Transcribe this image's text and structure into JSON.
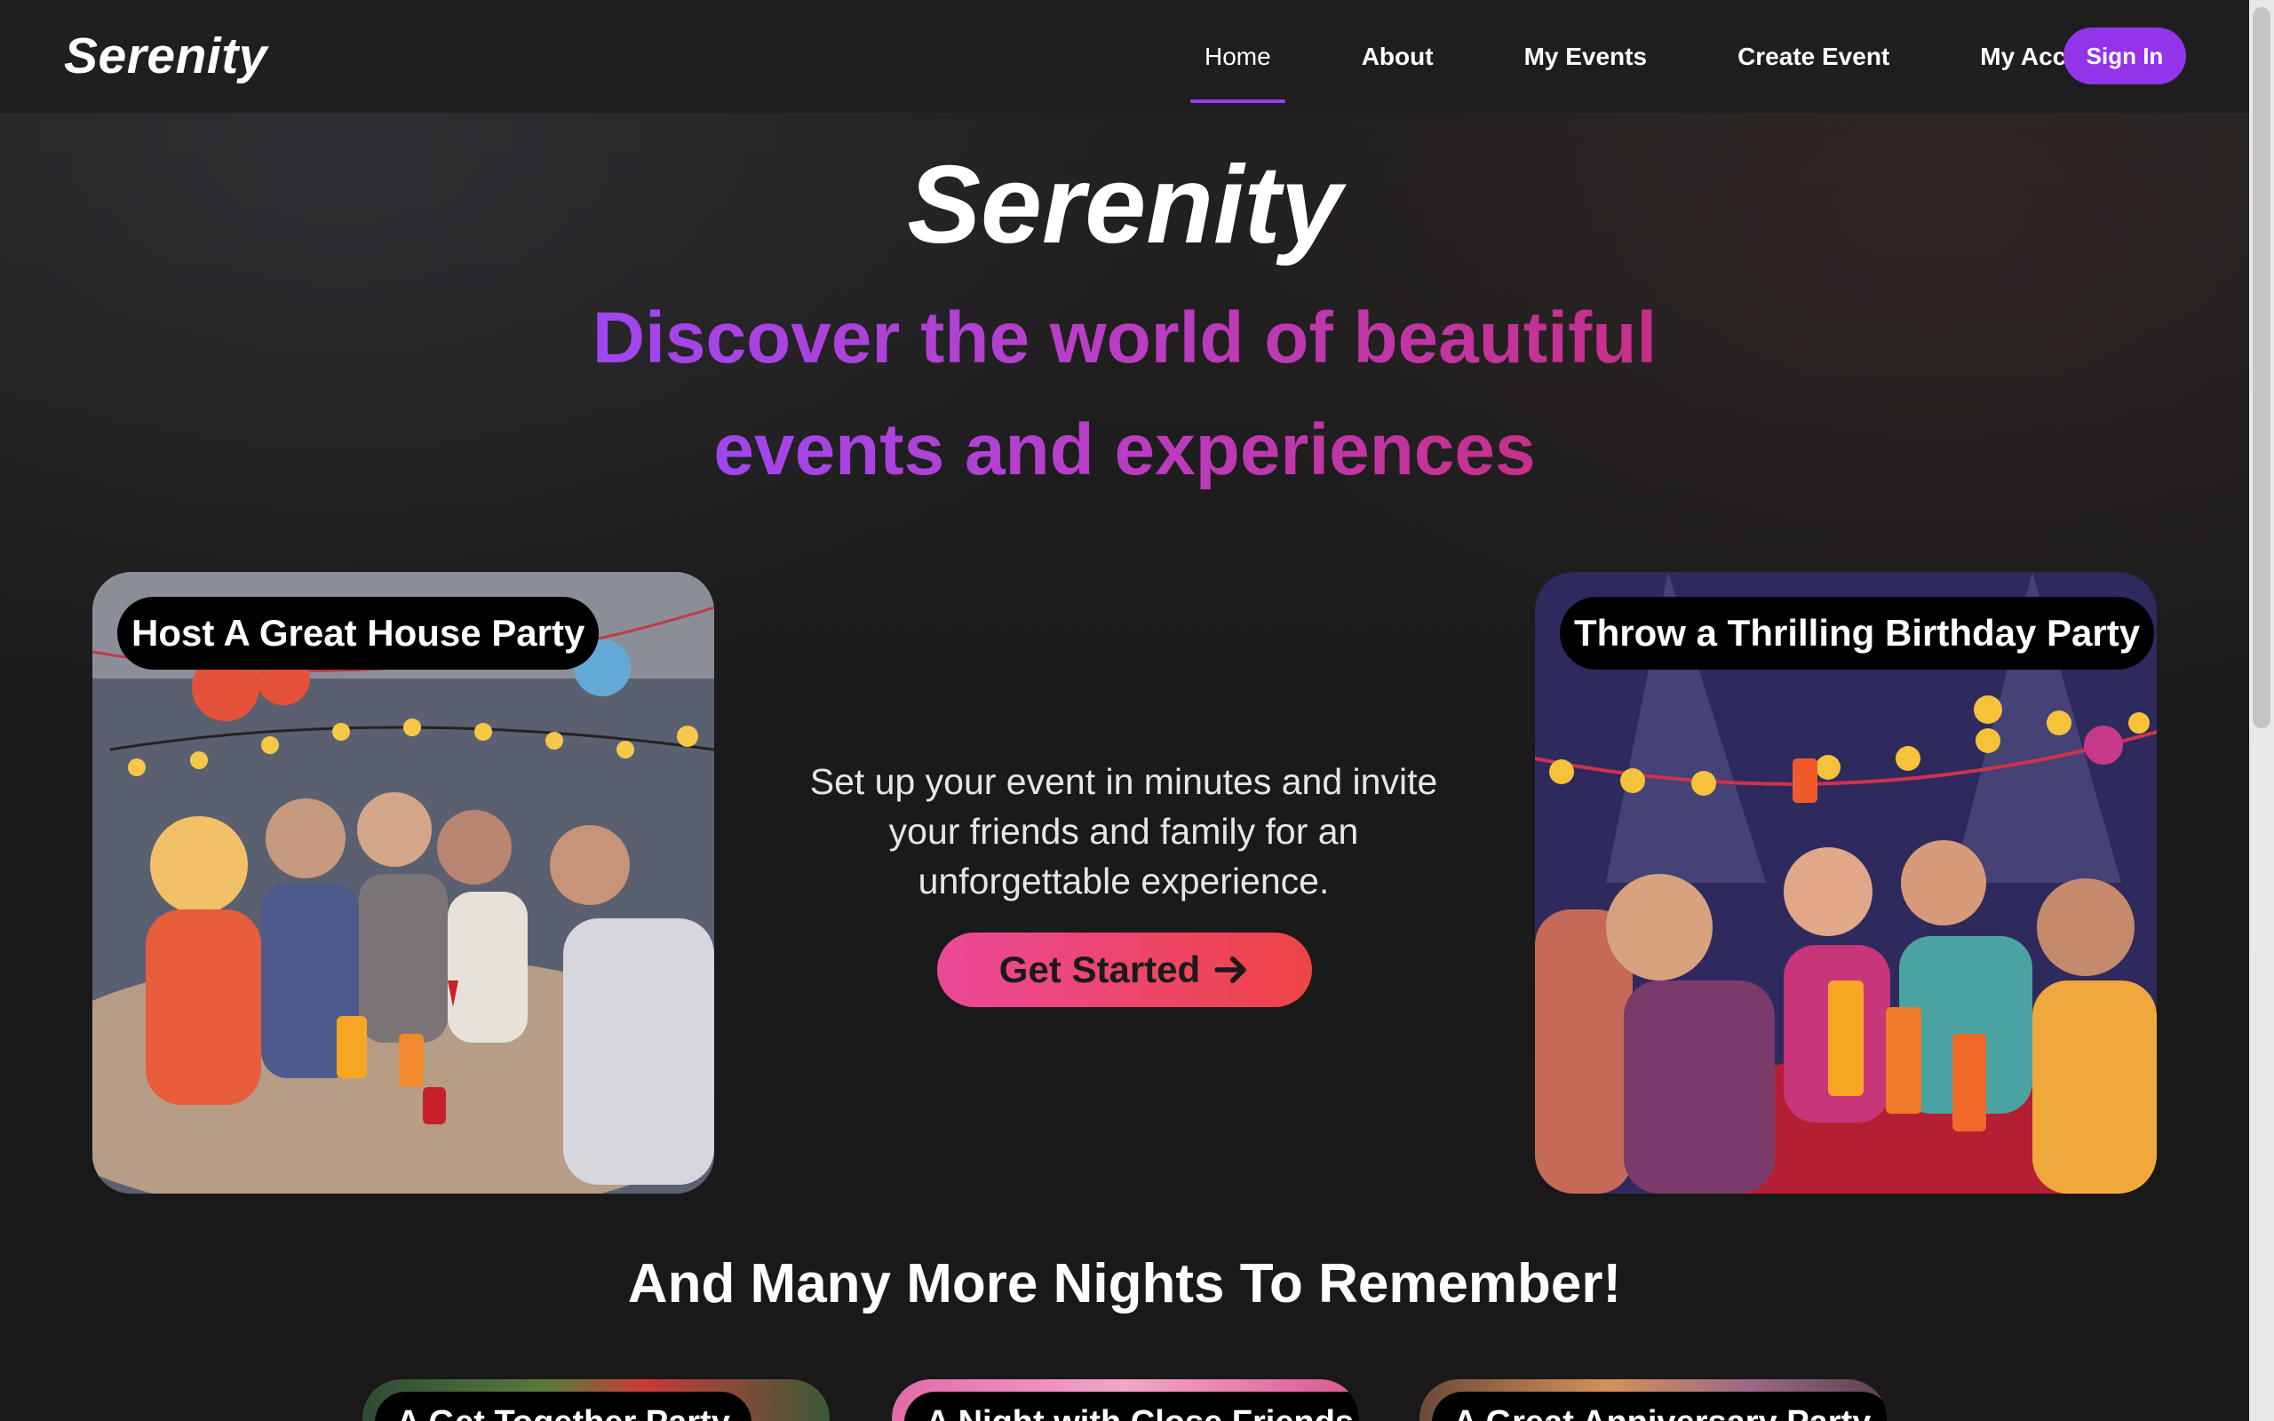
{
  "nav": {
    "brand": "Serenity",
    "links": [
      {
        "label": "Home",
        "active": true
      },
      {
        "label": "About",
        "active": false
      },
      {
        "label": "My Events",
        "active": false
      },
      {
        "label": "Create Event",
        "active": false
      },
      {
        "label": "My Account",
        "active": false
      }
    ],
    "signin_label": "Sign In"
  },
  "hero": {
    "title": "Serenity",
    "subtitle_line1": "Discover the world of beautiful",
    "subtitle_line2": "events and experiences"
  },
  "cards": {
    "left_label": "Host A Great House Party",
    "right_label": "Throw a Thrilling Birthday Party"
  },
  "center": {
    "description": "Set up your event in minutes and invite your friends and family for an unforgettable experience.",
    "cta_label": "Get Started"
  },
  "more": {
    "title": "And Many More Nights To Remember!",
    "cards": [
      {
        "label": "A Get Together Party"
      },
      {
        "label": "A Night with Close Friends"
      },
      {
        "label": "A Great Anniversary Party"
      }
    ]
  },
  "colors": {
    "accent": "#9333ea",
    "cta_start": "#ec4899",
    "cta_end": "#ef4444",
    "gradient_start": "#9f46f0",
    "gradient_end": "#c72f88"
  },
  "icons": {
    "cta_icon": "arrow-right-icon"
  }
}
